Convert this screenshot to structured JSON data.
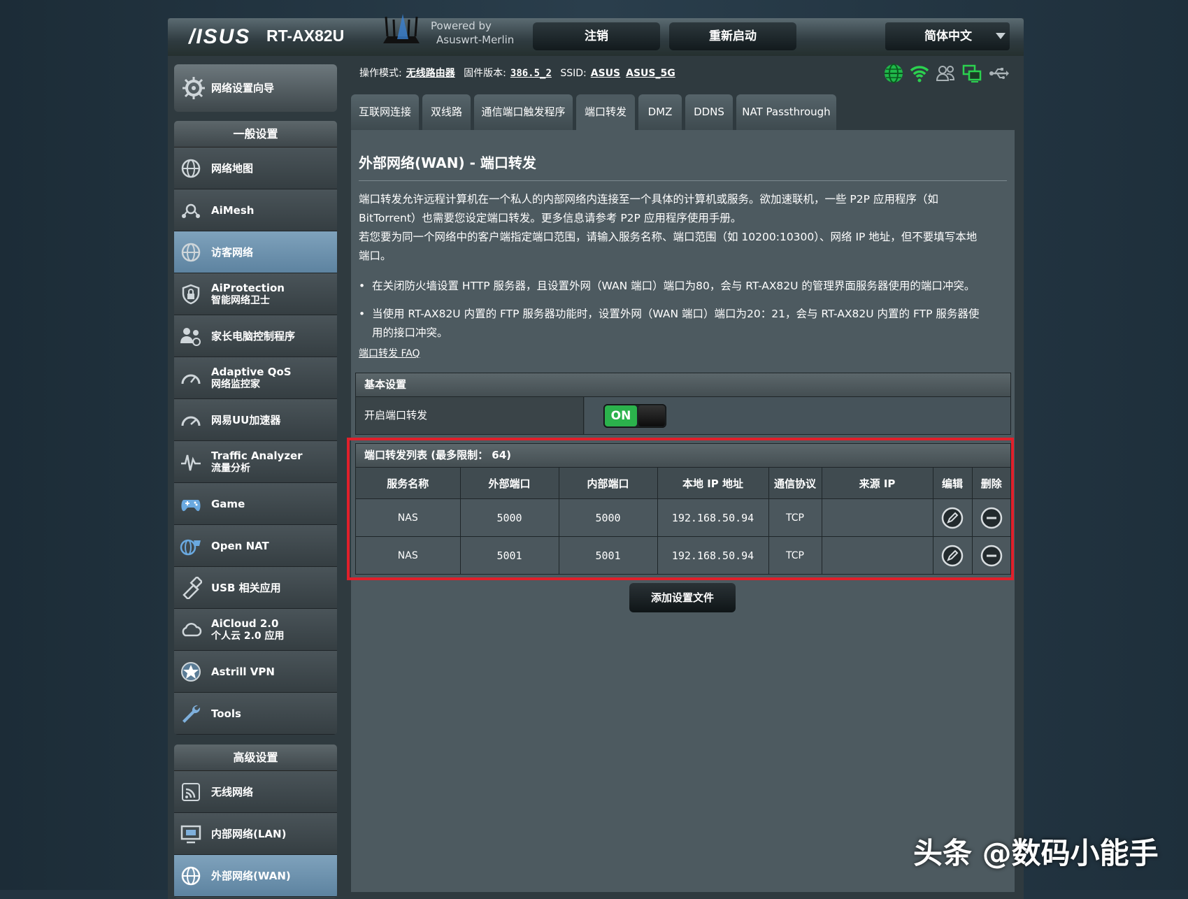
{
  "header": {
    "brand": "/ISUS",
    "model": "RT-AX82U",
    "powered_line1": "Powered by",
    "powered_line2": "Asuswrt-Merlin",
    "logout_label": "注销",
    "reboot_label": "重新启动",
    "language": "简体中文"
  },
  "status_bar": {
    "mode_label": "操作模式:",
    "mode_value": "无线路由器",
    "firmware_label": "固件版本:",
    "firmware_value": "386.5_2",
    "ssid_label": "SSID:",
    "ssid_1": "ASUS",
    "ssid_2": "ASUS_5G",
    "icons": [
      "internet-globe-icon",
      "wifi-icon",
      "clients-icon",
      "network-link-icon",
      "usb-icon"
    ]
  },
  "sidebar": {
    "qis_label": "网络设置向导",
    "general_header": "一般设置",
    "general_items": [
      {
        "label": "网络地图",
        "sub": "",
        "icon": "network-map-icon"
      },
      {
        "label": "AiMesh",
        "sub": "",
        "icon": "aimesh-icon"
      },
      {
        "label": "访客网络",
        "sub": "",
        "icon": "guest-network-icon"
      },
      {
        "label": "AiProtection",
        "sub": "智能网络卫士",
        "icon": "shield-lock-icon"
      },
      {
        "label": "家长电脑控制程序",
        "sub": "",
        "icon": "parental-control-icon"
      },
      {
        "label": "Adaptive QoS",
        "sub": "网络监控家",
        "icon": "gauge-icon"
      },
      {
        "label": "网易UU加速器",
        "sub": "",
        "icon": "accelerator-gauge-icon"
      },
      {
        "label": "Traffic Analyzer",
        "sub": "流量分析",
        "icon": "traffic-wave-icon"
      },
      {
        "label": "Game",
        "sub": "",
        "icon": "gamepad-icon"
      },
      {
        "label": "Open NAT",
        "sub": "",
        "icon": "open-nat-icon"
      },
      {
        "label": "USB 相关应用",
        "sub": "",
        "icon": "usb-apps-icon"
      },
      {
        "label": "AiCloud 2.0",
        "sub": "个人云 2.0 应用",
        "icon": "cloud-icon"
      },
      {
        "label": "Astrill VPN",
        "sub": "",
        "icon": "star-badge-icon"
      },
      {
        "label": "Tools",
        "sub": "",
        "icon": "wrench-icon"
      }
    ],
    "advanced_header": "高级设置",
    "advanced_items": [
      {
        "label": "无线网络",
        "sub": "",
        "icon": "wireless-icon"
      },
      {
        "label": "内部网络(LAN)",
        "sub": "",
        "icon": "lan-icon"
      },
      {
        "label": "外部网络(WAN)",
        "sub": "",
        "icon": "wan-globe-icon"
      }
    ]
  },
  "tabs": [
    "互联网连接",
    "双线路",
    "通信端口触发程序",
    "端口转发",
    "DMZ",
    "DDNS",
    "NAT Passthrough"
  ],
  "page": {
    "title": "外部网络(WAN) - 端口转发",
    "desc_line1": "端口转发允许远程计算机在一个私人的内部网络内连接至一个具体的计算机或服务。欲加速联机，一些 P2P 应用程序（如",
    "desc_line2": "BitTorrent）也需要您设定端口转发。更多信息请参考 P2P 应用程序使用手册。",
    "desc_line3": "若您要为同一个网络中的客户端指定端口范围，请输入服务名称、端口范围（如 10200:10300）、网络 IP 地址，但不要填写本地",
    "desc_line4": "端口。",
    "bullet1": "在关闭防火墙设置 HTTP 服务器，且设置外网（WAN 端口）端口为80，会与 RT-AX82U 的管理界面服务器使用的端口冲突。",
    "bullet2_line1": "当使用 RT-AX82U 内置的 FTP 服务器功能时，设置外网（WAN 端口）端口为20：21，会与 RT-AX82U 内置的 FTP 服务器使",
    "bullet2_line2": "用的接口冲突。",
    "faq_link": "端口转发 FAQ"
  },
  "basic_settings": {
    "header": "基本设置",
    "enable_label": "开启端口转发",
    "toggle_state": "ON"
  },
  "port_forward_list": {
    "title": "端口转发列表 (最多限制： 64)",
    "columns": [
      "服务名称",
      "外部端口",
      "内部端口",
      "本地 IP 地址",
      "通信协议",
      "来源 IP",
      "编辑",
      "删除"
    ],
    "rows": [
      {
        "service": "NAS",
        "external": "5000",
        "internal": "5000",
        "ip": "192.168.50.94",
        "protocol": "TCP",
        "source": ""
      },
      {
        "service": "NAS",
        "external": "5001",
        "internal": "5001",
        "ip": "192.168.50.94",
        "protocol": "TCP",
        "source": ""
      }
    ]
  },
  "add_button_label": "添加设置文件",
  "watermark": "头条 @数码小能手",
  "colors": {
    "accent_red": "#e0202b",
    "toggle_green": "#2bb24c",
    "active_menu": "#6f94b0"
  }
}
